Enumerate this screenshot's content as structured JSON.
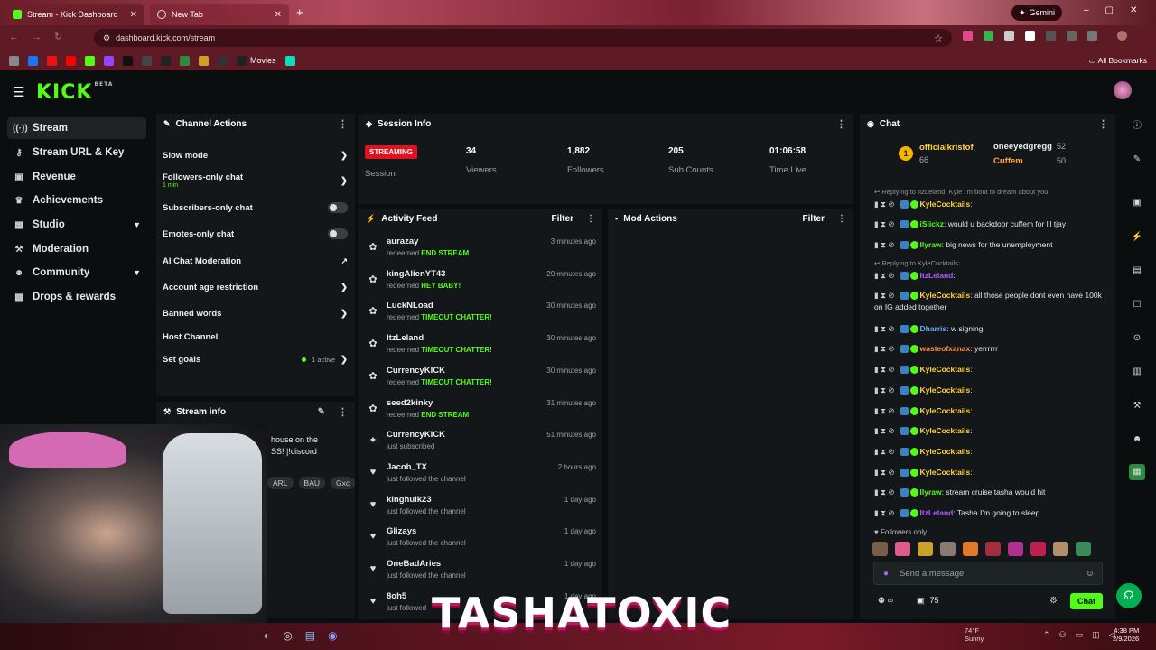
{
  "browser": {
    "tabs": [
      {
        "title": "Stream - Kick Dashboard",
        "active": true
      },
      {
        "title": "New Tab",
        "active": false
      }
    ],
    "url": "dashboard.kick.com/stream",
    "gemini_label": "Gemini",
    "bookmarks_movies": "Movies",
    "all_bookmarks": "All Bookmarks"
  },
  "brand": {
    "logo": "KICK",
    "beta": "BETA",
    "accent": "#53fc18"
  },
  "sidebar": {
    "items": [
      {
        "label": "Stream",
        "icon": "broadcast-icon",
        "glyph": "((·))"
      },
      {
        "label": "Stream URL & Key",
        "icon": "key-icon",
        "glyph": "⚷"
      },
      {
        "label": "Revenue",
        "icon": "revenue-icon",
        "glyph": "▣"
      },
      {
        "label": "Achievements",
        "icon": "trophy-icon",
        "glyph": "♛"
      },
      {
        "label": "Studio",
        "icon": "studio-icon",
        "glyph": "▦"
      },
      {
        "label": "Moderation",
        "icon": "wrench-icon",
        "glyph": "⚒"
      },
      {
        "label": "Community",
        "icon": "community-icon",
        "glyph": "☻"
      },
      {
        "label": "Drops & rewards",
        "icon": "gift-icon",
        "glyph": "▩"
      }
    ]
  },
  "channel_actions": {
    "title": "Channel Actions",
    "rows": [
      {
        "label": "Slow mode"
      },
      {
        "label": "Followers-only chat",
        "sub": "1 min"
      },
      {
        "label": "Subscribers-only chat"
      },
      {
        "label": "Emotes-only chat"
      },
      {
        "label": "AI Chat Moderation"
      },
      {
        "label": "Account age restriction"
      },
      {
        "label": "Banned words"
      },
      {
        "label": "Host Channel"
      },
      {
        "label": "Set goals",
        "sub": "1 active"
      }
    ]
  },
  "stream_info": {
    "title": "Stream info",
    "text_line1": "house on the",
    "text_line2": "SS! |!discord",
    "tags": [
      "ARL",
      "BAU",
      "Gxc"
    ]
  },
  "session_info": {
    "title": "Session Info",
    "status": "STREAMING",
    "status_sub": "Session",
    "stats": [
      {
        "value": "34",
        "label": "Viewers"
      },
      {
        "value": "1,882",
        "label": "Followers"
      },
      {
        "value": "205",
        "label": "Sub Counts"
      },
      {
        "value": "01:06:58",
        "label": "Time Live"
      }
    ]
  },
  "activity_feed": {
    "title": "Activity Feed",
    "filter": "Filter",
    "items": [
      {
        "name": "aurazay",
        "verb": "redeemed",
        "reward": "END STREAM",
        "time": "3 minutes ago",
        "icon": "reward-icon"
      },
      {
        "name": "kingAlienYT43",
        "verb": "redeemed",
        "reward": "HEY BABY!",
        "time": "29 minutes ago",
        "icon": "reward-icon"
      },
      {
        "name": "LuckNLoad",
        "verb": "redeemed",
        "reward": "TIMEOUT CHATTER!",
        "time": "30 minutes ago",
        "icon": "reward-icon"
      },
      {
        "name": "ItzLeland",
        "verb": "redeemed",
        "reward": "TIMEOUT CHATTER!",
        "time": "30 minutes ago",
        "icon": "reward-icon"
      },
      {
        "name": "CurrencyKICK",
        "verb": "redeemed",
        "reward": "TIMEOUT CHATTER!",
        "time": "30 minutes ago",
        "icon": "reward-icon"
      },
      {
        "name": "seed2kinky",
        "verb": "redeemed",
        "reward": "END STREAM",
        "time": "31 minutes ago",
        "icon": "reward-icon"
      },
      {
        "name": "CurrencyKICK",
        "verb": "just subscribed",
        "reward": "",
        "time": "51 minutes ago",
        "icon": "star-icon"
      },
      {
        "name": "Jacob_TX",
        "verb": "just followed the channel",
        "reward": "",
        "time": "2 hours ago",
        "icon": "heart-icon"
      },
      {
        "name": "kinghulk23",
        "verb": "just followed the channel",
        "reward": "",
        "time": "1 day ago",
        "icon": "heart-icon"
      },
      {
        "name": "Glizays",
        "verb": "just followed the channel",
        "reward": "",
        "time": "1 day ago",
        "icon": "heart-icon"
      },
      {
        "name": "OneBadAries",
        "verb": "just followed the channel",
        "reward": "",
        "time": "1 day ago",
        "icon": "heart-icon"
      },
      {
        "name": "8oh5",
        "verb": "just followed",
        "reward": "",
        "time": "1 day ago",
        "icon": "heart-icon"
      }
    ]
  },
  "mod_actions": {
    "title": "Mod Actions",
    "filter": "Filter"
  },
  "chat": {
    "title": "Chat",
    "leaders": [
      {
        "name": "officialkristof",
        "count": "66"
      },
      {
        "name": "oneeyedgregg",
        "count": "52"
      },
      {
        "name": "Cuffem",
        "count": "50"
      }
    ],
    "messages": [
      {
        "reply": "Replying to ItzLeland: Kyle I'm bout to dream about you"
      },
      {
        "user": "KyleCocktails",
        "color": "#ffd23f",
        "text": ""
      },
      {
        "user": "iSlickz",
        "color": "#53fc18",
        "text": "would u backdoor cuffem for lil tjay"
      },
      {
        "user": "llyraw",
        "color": "#53fc18",
        "text": "big news for the unemployment"
      },
      {
        "reply": "Replying to KyleCocktails:"
      },
      {
        "user": "ItzLeland",
        "color": "#b45cff",
        "text": ""
      },
      {
        "user": "KyleCocktails",
        "color": "#ffd23f",
        "text": "all those people dont even have 100k on IG added together"
      },
      {
        "user": "Dharris",
        "color": "#6aa6ff",
        "text": "w signing"
      },
      {
        "user": "wasteofxanax",
        "color": "#ff8a3d",
        "text": "yerrrrrr"
      },
      {
        "user": "KyleCocktails",
        "color": "#ffd23f",
        "text": ""
      },
      {
        "user": "KyleCocktails",
        "color": "#ffd23f",
        "text": ""
      },
      {
        "user": "KyleCocktails",
        "color": "#ffd23f",
        "text": ""
      },
      {
        "user": "KyleCocktails",
        "color": "#ffd23f",
        "text": ""
      },
      {
        "user": "KyleCocktails",
        "color": "#ffd23f",
        "text": ""
      },
      {
        "user": "KyleCocktails",
        "color": "#ffd23f",
        "text": ""
      },
      {
        "user": "llyraw",
        "color": "#53fc18",
        "text": "stream cruise tasha would hit"
      },
      {
        "user": "ItzLeland",
        "color": "#b45cff",
        "text": "Tasha I'm going to sleep"
      }
    ],
    "followers_only": "Followers only",
    "placeholder": "Send a message",
    "points": "75",
    "send": "Chat"
  },
  "overlay": {
    "text": "TASHATOXIC"
  },
  "taskbar": {
    "weather": "74°F",
    "weather_sub": "Sunny",
    "time": "4:38 PM",
    "date": "2/9/2026"
  }
}
